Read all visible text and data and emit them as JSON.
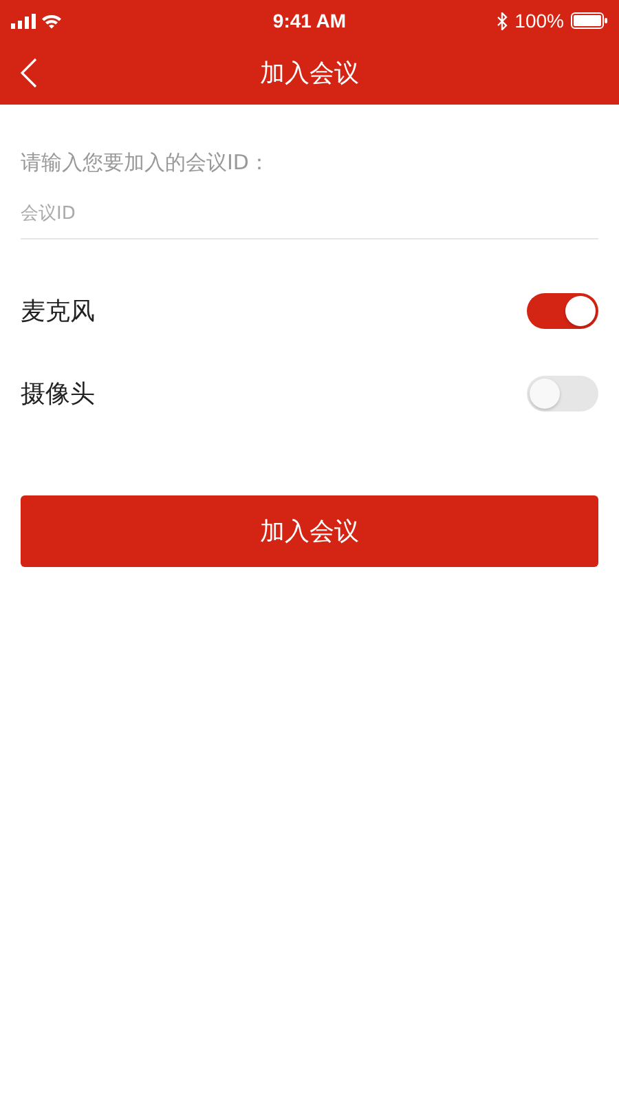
{
  "status_bar": {
    "time": "9:41 AM",
    "battery": "100%"
  },
  "nav_bar": {
    "title": "加入会议"
  },
  "form": {
    "prompt": "请输入您要加入的会议ID：",
    "meeting_id": {
      "placeholder": "会议ID"
    }
  },
  "toggles": [
    {
      "label": "麦克风",
      "on": true
    },
    {
      "label": "摄像头",
      "on": false
    }
  ],
  "join_button": {
    "label": "加入会议"
  }
}
